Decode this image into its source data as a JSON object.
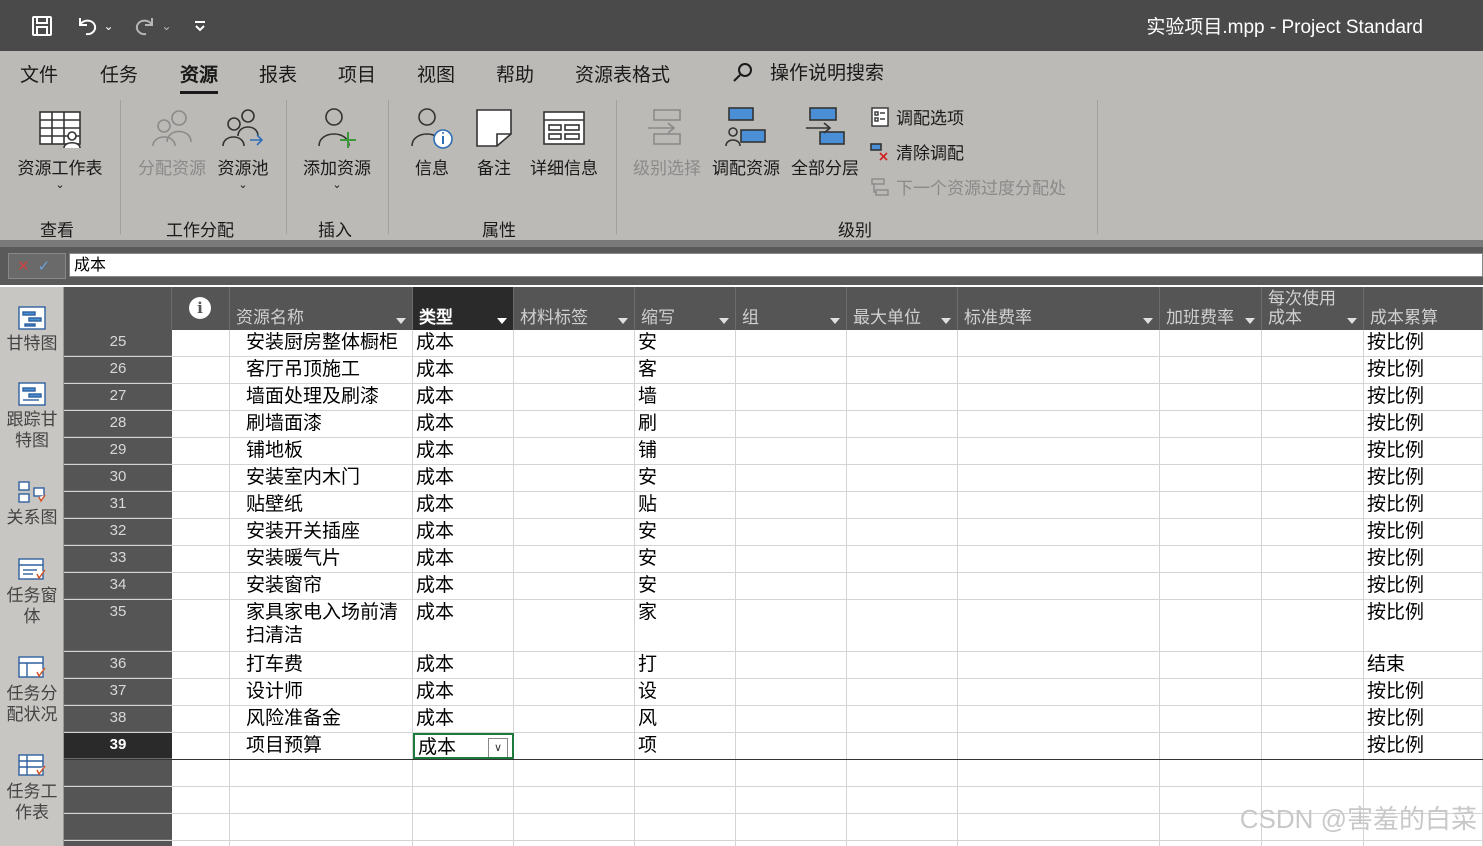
{
  "titlebar": {
    "title": "实验项目.mpp  -  Project Standard"
  },
  "menu": {
    "tabs": [
      "文件",
      "任务",
      "资源",
      "报表",
      "项目",
      "视图",
      "帮助",
      "资源表格式"
    ],
    "active_tab": "资源",
    "search_label": "操作说明搜索"
  },
  "ribbon": {
    "resource_sheet": "资源工作表",
    "assign_resources": "分配资源",
    "resource_pool": "资源池",
    "add_resources": "添加资源",
    "information": "信息",
    "notes": "备注",
    "details": "详细信息",
    "level_selection": "级别选择",
    "level_resource": "调配资源",
    "level_all": "全部分层",
    "leveling_options": "调配选项",
    "clear_leveling": "清除调配",
    "next_overallocation": "下一个资源过度分配处",
    "groups": {
      "view": "查看",
      "assignments": "工作分配",
      "insert": "插入",
      "properties": "属性",
      "level": "级别"
    }
  },
  "formula_bar": {
    "value": "成本"
  },
  "view_bar": {
    "items": [
      "甘特图",
      "跟踪甘特图",
      "关系图",
      "任务窗体",
      "任务分配状况",
      "任务工作表"
    ]
  },
  "table": {
    "columns": [
      "资源名称",
      "类型",
      "材料标签",
      "缩写",
      "组",
      "最大单位",
      "标准费率",
      "加班费率",
      "每次使用成本",
      "成本累算"
    ],
    "rows": [
      {
        "id": "25",
        "name": "安装厨房整体橱柜",
        "type": "成本",
        "initials": "安",
        "accrue": "按比例"
      },
      {
        "id": "26",
        "name": "客厅吊顶施工",
        "type": "成本",
        "initials": "客",
        "accrue": "按比例"
      },
      {
        "id": "27",
        "name": "墙面处理及刷漆",
        "type": "成本",
        "initials": "墙",
        "accrue": "按比例"
      },
      {
        "id": "28",
        "name": "刷墙面漆",
        "type": "成本",
        "initials": "刷",
        "accrue": "按比例"
      },
      {
        "id": "29",
        "name": "铺地板",
        "type": "成本",
        "initials": "铺",
        "accrue": "按比例"
      },
      {
        "id": "30",
        "name": "安装室内木门",
        "type": "成本",
        "initials": "安",
        "accrue": "按比例"
      },
      {
        "id": "31",
        "name": "贴壁纸",
        "type": "成本",
        "initials": "贴",
        "accrue": "按比例"
      },
      {
        "id": "32",
        "name": "安装开关插座",
        "type": "成本",
        "initials": "安",
        "accrue": "按比例"
      },
      {
        "id": "33",
        "name": "安装暖气片",
        "type": "成本",
        "initials": "安",
        "accrue": "按比例"
      },
      {
        "id": "34",
        "name": "安装窗帘",
        "type": "成本",
        "initials": "安",
        "accrue": "按比例"
      },
      {
        "id": "35",
        "name": "家具家电入场前清扫清洁",
        "type": "成本",
        "initials": "家",
        "accrue": "按比例"
      },
      {
        "id": "36",
        "name": "打车费",
        "type": "成本",
        "initials": "打",
        "accrue": "结束"
      },
      {
        "id": "37",
        "name": "设计师",
        "type": "成本",
        "initials": "设",
        "accrue": "按比例"
      },
      {
        "id": "38",
        "name": "风险准备金",
        "type": "成本",
        "initials": "风",
        "accrue": "按比例"
      },
      {
        "id": "39",
        "name": "项目预算",
        "type": "成本",
        "initials": "项",
        "accrue": "按比例"
      }
    ]
  },
  "watermark": "CSDN @害羞的白菜"
}
